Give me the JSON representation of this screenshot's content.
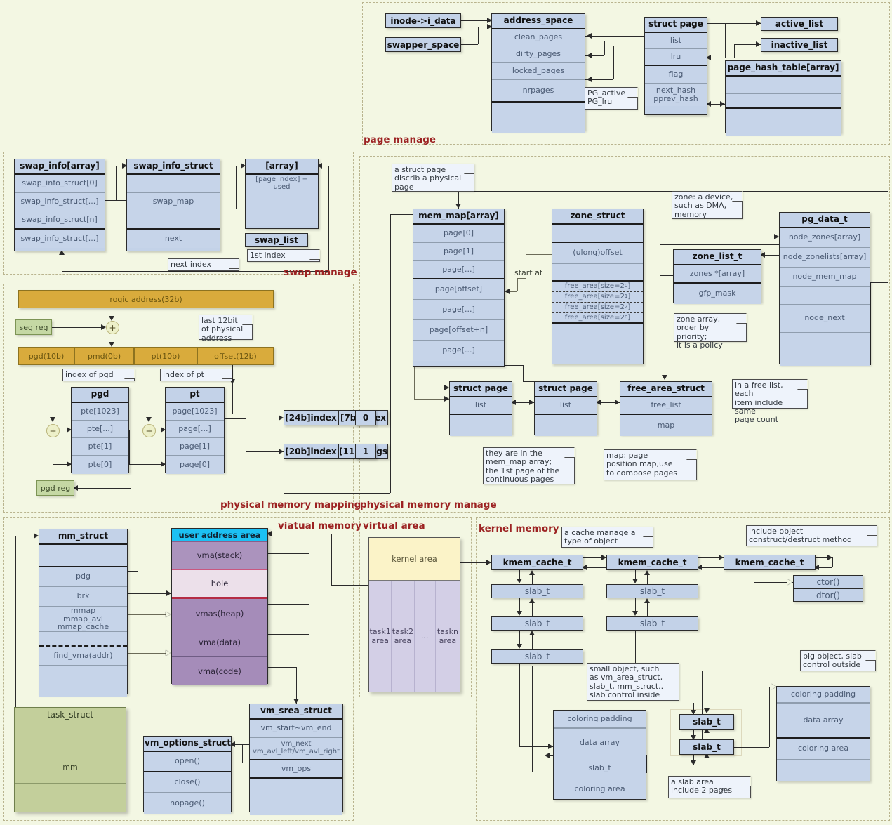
{
  "sections": {
    "page_manage": "page manage",
    "swap_manage": "swap manage",
    "physical_memory_mapping": "physical memory mapping",
    "physical_memory_manage": "physical memory manage",
    "viatual_memory": "viatual memory",
    "virtual_area": "virtual area",
    "kernel_memory": "kernel memory"
  },
  "page_manage": {
    "inode": "inode->i_data",
    "swapper_space": "swapper_space",
    "address_space": {
      "title": "address_space",
      "rows": [
        "clean_pages",
        "dirty_pages",
        "locked_pages",
        "nrpages",
        ""
      ]
    },
    "struct_page": {
      "title": "struct page",
      "rows": [
        "list",
        "lru",
        "flag",
        "next_hash\npprev_hash"
      ]
    },
    "pg_note": "PG_active\nPG_lru",
    "active_list": "active_list",
    "inactive_list": "inactive_list",
    "page_hash_table": {
      "title": "page_hash_table[array]",
      "rows": [
        "",
        "",
        "",
        ""
      ]
    }
  },
  "swap_manage": {
    "swap_info_array": {
      "title": "swap_info[array]",
      "rows": [
        "swap_info_struct[0]",
        "swap_info_struct[...]",
        "swap_info_struct[n]",
        "swap_info_struct[...]"
      ]
    },
    "swap_info_struct": {
      "title": "swap_info_struct",
      "rows": [
        "",
        "swap_map",
        "",
        "next"
      ]
    },
    "array": {
      "title": "[array]",
      "rows": [
        "[page index] = used",
        "",
        ""
      ]
    },
    "swap_list": "swap_list",
    "note_first_index": "1st index",
    "note_next_index": "next index"
  },
  "mapping": {
    "logic_address": "rogic address(32b)",
    "seg_reg": "seg reg",
    "pgd_reg": "pgd reg",
    "note_last12": "last 12bit\nof physical\naddress",
    "fields": [
      "pgd(10b)",
      "pmd(0b)",
      "pt(10b)",
      "offset(12b)"
    ],
    "note_index_pgd": "index of pgd",
    "note_index_pt": "index of pt",
    "pgd": {
      "title": "pgd",
      "rows": [
        "pte[1023]",
        "pte[...]",
        "pte[1]",
        "pte[0]"
      ]
    },
    "pt": {
      "title": "pt",
      "rows": [
        "page[1023]",
        "page[...]",
        "page[1]",
        "page[0]"
      ]
    },
    "entry_top": [
      "[24b]index",
      "[7b]index",
      "0"
    ],
    "entry_bottom": [
      "[20b]index",
      "[11b]flags",
      "1"
    ],
    "plus_symbol": "+"
  },
  "phys_manage": {
    "note_struct_page": "a struct page\ndiscrib a physical\npage",
    "mem_map": {
      "title": "mem_map[array]",
      "rows": [
        "page[0]",
        "page[1]",
        "page[...]",
        "page[offset]",
        "page[...]",
        "page[offset+n]",
        "page[...]"
      ]
    },
    "start_at": "start at",
    "zone_struct": {
      "title": "zone_struct",
      "rows": [
        "",
        "(ulong)offset",
        ""
      ],
      "free_areas": [
        "free_area[size=2",
        "free_area[size=2",
        "free_area[size=2",
        "free_area[size=2"
      ],
      "free_area_exps": [
        "0",
        "1",
        "2",
        "n"
      ]
    },
    "note_zone": "zone: a device,\nsuch as DMA,\nmemory",
    "zone_list_t": {
      "title": "zone_list_t",
      "rows": [
        "zones *[array]",
        "gfp_mask"
      ]
    },
    "note_zone_array": "zone array,\norder by priority;\nit is a policy",
    "pg_data_t": {
      "title": "pg_data_t",
      "rows": [
        "node_zones[array]",
        "node_zonelists[array]",
        "node_mem_map",
        "",
        "node_next",
        ""
      ]
    },
    "struct_page_a": {
      "title": "struct page",
      "rows": [
        "list",
        ""
      ]
    },
    "struct_page_b": {
      "title": "struct page",
      "rows": [
        "list",
        ""
      ]
    },
    "free_area_struct": {
      "title": "free_area_struct",
      "rows": [
        "free_list",
        "map"
      ]
    },
    "note_free_list": "in a free list, each\nitem include same\npage count",
    "note_they_are": "they are in the\nmem_map array;\nthe 1st page of the\ncontinuous pages",
    "note_map": "map: page\nposition map,use\nto compose pages"
  },
  "virtual_memory": {
    "mm_struct": {
      "title": "mm_struct",
      "rows": [
        "",
        "pdg",
        "brk",
        "mmap\nmmap_avl\nmmap_cache",
        "",
        "find_vma(addr)",
        ""
      ]
    },
    "user_address_area": {
      "title": "user address area",
      "segments": [
        "vma(stack)",
        "hole",
        "vmas(heap)",
        "vma(data)",
        "vma(code)"
      ]
    },
    "task_struct": {
      "title": "task_struct",
      "rows": [
        "",
        "mm",
        ""
      ]
    },
    "vm_options_struct": {
      "title": "vm_options_struct",
      "rows": [
        "open()",
        "close()",
        "nopage()"
      ]
    },
    "vm_srea_struct": {
      "title": "vm_srea_struct",
      "rows": [
        "vm_start~vm_end",
        "vm_next\nvm_avl_left/vm_avl_right",
        "vm_ops",
        ""
      ]
    }
  },
  "virtual_area": {
    "kernel_area": "kernel area",
    "tasks": [
      "task1\narea",
      "task2\narea",
      "...",
      "taskn\narea"
    ]
  },
  "kernel_memory": {
    "note_cache": "a cache manage a\ntype of object",
    "note_include_object": "include object\nconstruct/destruct method",
    "caches": [
      "kmem_cache_t",
      "kmem_cache_t",
      "kmem_cache_t"
    ],
    "slab_label": "slab_t",
    "ctor": "ctor()",
    "dtor": "dtor()",
    "note_small_object": "small object, such\nas vm_area_struct,\nslab_t, mm_struct..\nslab control inside",
    "note_big_object": "big object, slab\ncontrol outside",
    "note_slab_area": "a slab area\ninclude 2  pages",
    "note_slab_area_exp": "n",
    "slab_box_left": {
      "rows": [
        "coloring padding",
        "data array",
        "slab_t",
        "coloring area"
      ]
    },
    "slab_box_right": {
      "rows": [
        "coloring padding",
        "data array",
        "coloring area",
        ""
      ]
    }
  },
  "colors": {
    "background": "#f3f7e3",
    "struct_fill": "#c3d2e8",
    "gold": "#d9ab3c",
    "green_reg": "#c5d8a4",
    "section_label": "#9c2222",
    "user_area_header": "#1cc0f3"
  }
}
